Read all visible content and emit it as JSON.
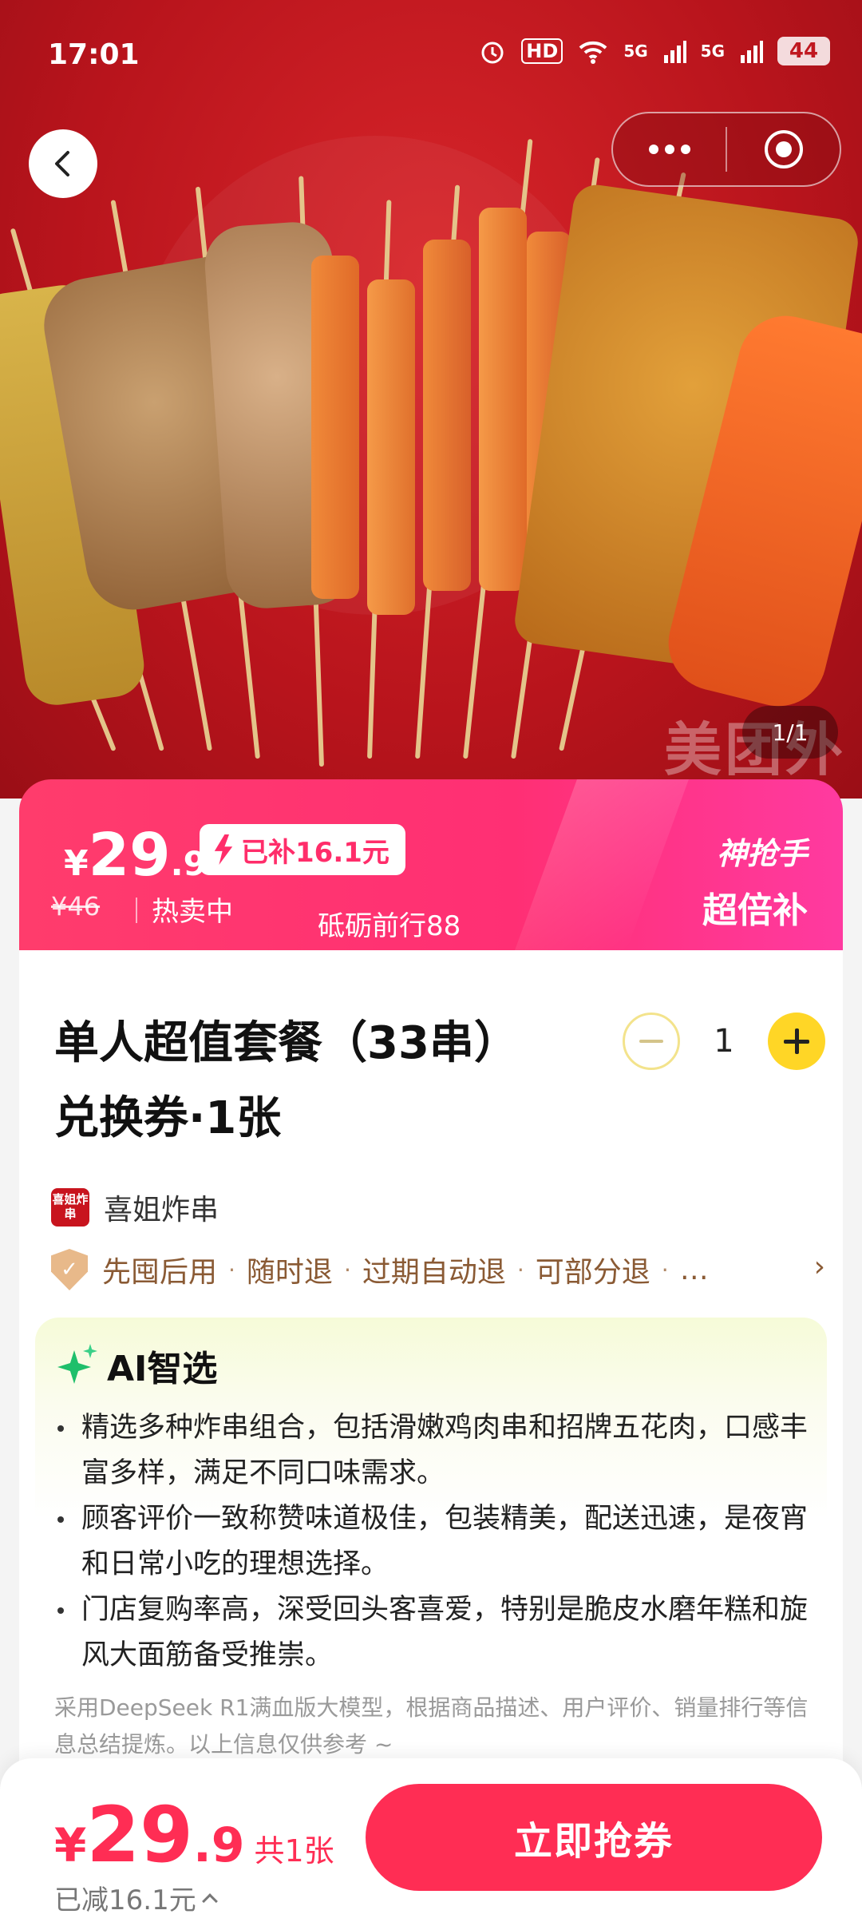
{
  "status_bar": {
    "time": "17:01",
    "hd_label": "HD",
    "net1": "5G",
    "net2": "5G",
    "battery": "44"
  },
  "hero": {
    "image_counter": "1/1",
    "watermark": "美团外"
  },
  "price_banner": {
    "currency": "¥",
    "price_int": "29",
    "price_dec": ".9",
    "subsidy_tag": "已补16.1元",
    "original_price": "¥46",
    "hot_label": "热卖中",
    "comment": "砥砺前行88",
    "promo_line1": "神抢手",
    "promo_line2": "超倍补"
  },
  "product": {
    "title_line1": "单人超值套餐（33串）",
    "title_line2": "兑换券·1张",
    "quantity": "1"
  },
  "shop": {
    "logo_text": "喜姐炸串",
    "name": "喜姐炸串"
  },
  "guarantees": [
    "先囤后用",
    "随时退",
    "过期自动退",
    "可部分退",
    "…"
  ],
  "ai_section": {
    "title": "AI智选",
    "points": [
      "精选多种炸串组合，包括滑嫩鸡肉串和招牌五花肉，口感丰富多样，满足不同口味需求。",
      "顾客评价一致称赞味道极佳，包装精美，配送迅速，是夜宵和日常小吃的理想选择。",
      "门店复购率高，深受回头客喜爱，特别是脆皮水磨年糕和旋风大面筋备受推崇。"
    ],
    "disclaimer": "采用DeepSeek R1满血版大模型，根据商品描述、用户评价、销量排行等信息总结提炼。以上信息仅供参考 ~"
  },
  "bottom_bar": {
    "currency": "¥",
    "price_int": "29",
    "price_dec": ".9",
    "quantity_text": "共1张",
    "saved_text": "已减16.1元",
    "buy_label": "立即抢券"
  },
  "colors": {
    "hero_red": "#c01820",
    "banner_pink": "#ff2f74",
    "accent_red": "#ff2d54",
    "stepper_yellow": "#ffd626",
    "guarantee_brown": "#8a5a34",
    "ai_green": "#1fbf6b"
  },
  "icons": [
    "back-arrow-icon",
    "more-dots-icon",
    "target-icon",
    "alarm-icon",
    "wifi-icon",
    "signal-icon",
    "battery-icon",
    "lightning-icon",
    "minus-icon",
    "plus-icon",
    "shield-icon",
    "chevron-right-icon",
    "sparkle-icon",
    "caret-up-icon"
  ]
}
